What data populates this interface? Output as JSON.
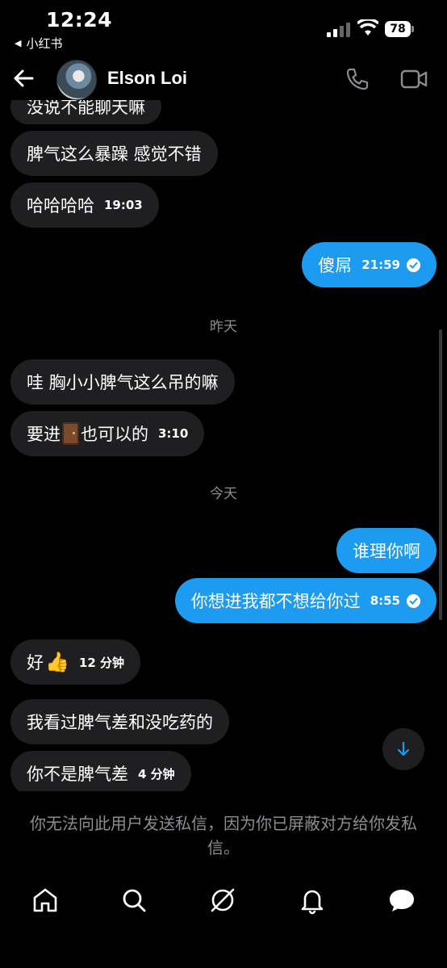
{
  "status_bar": {
    "time": "12:24",
    "back_app": "小红书",
    "battery": "78"
  },
  "header": {
    "name": "Elson Loi"
  },
  "messages": [
    {
      "side": "in",
      "text": "没说不能聊天嘛",
      "time": ""
    },
    {
      "side": "in",
      "text": "脾气这么暴躁 感觉不错",
      "time": ""
    },
    {
      "side": "in",
      "text": "哈哈哈哈",
      "time": "19:03"
    },
    {
      "side": "out",
      "text": "傻屌",
      "time": "21:59"
    },
    {
      "side": "in",
      "text": "哇 胸小小脾气这么吊的嘛",
      "time": ""
    },
    {
      "side": "in",
      "text_before": "要进",
      "text_after": "也可以的",
      "time": "3:10"
    },
    {
      "side": "out",
      "text": "谁理你啊",
      "time": ""
    },
    {
      "side": "out",
      "text": "你想进我都不想给你过",
      "time": "8:55"
    },
    {
      "side": "in",
      "text": "好",
      "time": "12 分钟"
    },
    {
      "side": "in",
      "text": "我看过脾气差和没吃药的",
      "time": ""
    },
    {
      "side": "in",
      "text": "你不是脾气差",
      "time": "4 分钟"
    }
  ],
  "day_separators": {
    "yesterday": "昨天",
    "today": "今天"
  },
  "notice": "你无法向此用户发送私信，因为你已屏蔽对方给你发私信。",
  "icons": {
    "back": "arrow-left-icon",
    "phone": "phone-icon",
    "video": "video-icon",
    "home": "home-icon",
    "search": "search-icon",
    "grok": "grok-icon",
    "notifications": "bell-icon",
    "messages": "chat-bubble-icon"
  },
  "colors": {
    "accent": "#1d9bf0",
    "incoming_bubble": "#1f1f21",
    "muted": "#8a8d91"
  }
}
